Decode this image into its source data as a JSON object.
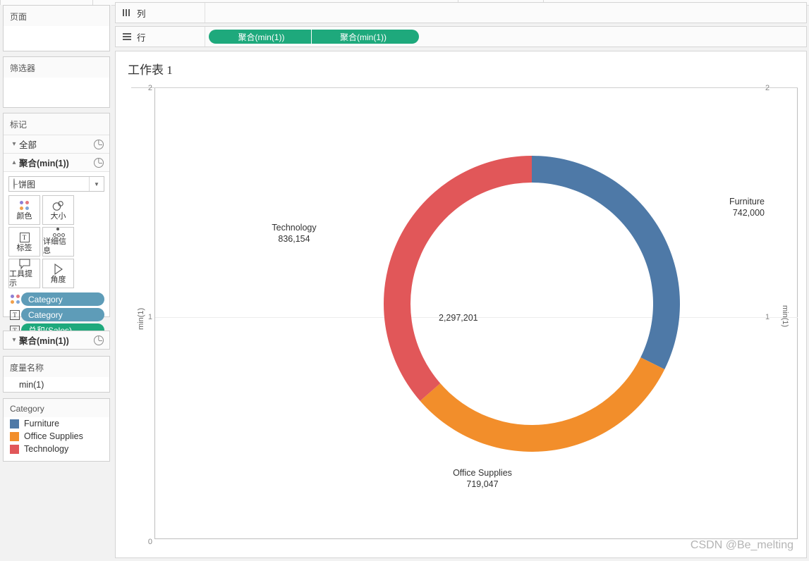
{
  "app": {
    "worksheet_title": "工作表 1",
    "watermark": "CSDN @Be_melting"
  },
  "shelves": {
    "columns": {
      "label": "列",
      "icon": "columns-icon",
      "pills": []
    },
    "rows": {
      "label": "行",
      "icon": "rows-icon",
      "pills": [
        "聚合(min(1))",
        "聚合(min(1))"
      ]
    }
  },
  "sidebar": {
    "pages": {
      "title": "页面"
    },
    "filters": {
      "title": "筛选器"
    },
    "marks": {
      "title": "标记",
      "rows": [
        {
          "label": "全部",
          "caret": "chevron-down",
          "icon": "pie-icon",
          "bold": false
        },
        {
          "label": "聚合(min(1))",
          "caret": "chevron-up",
          "icon": "pie-icon",
          "bold": true
        }
      ],
      "mark_type": "饼图",
      "buttons": [
        {
          "label": "颜色",
          "icon": "color-dots-icon"
        },
        {
          "label": "大小",
          "icon": "size-icon"
        },
        {
          "label": "标签",
          "icon": "label-text-icon"
        },
        {
          "label": "详细信息",
          "icon": "detail-dots-icon"
        },
        {
          "label": "工具提示",
          "icon": "tooltip-icon"
        },
        {
          "label": "角度",
          "icon": "angle-icon"
        }
      ],
      "pills": [
        {
          "text": "Category",
          "color": "blue",
          "icon": "color-dots-icon"
        },
        {
          "text": "Category",
          "color": "blue",
          "icon": "label-text-icon"
        },
        {
          "text": "总和(Sales)",
          "color": "green",
          "icon": "label-text-icon"
        }
      ],
      "second_card": {
        "label": "聚合(min(1))",
        "caret": "chevron-down",
        "icon": "pie-icon"
      }
    },
    "measure_names": {
      "title": "度量名称",
      "item": "min(1)"
    },
    "legend": {
      "title": "Category",
      "items": [
        {
          "label": "Furniture",
          "color": "#4e79a7"
        },
        {
          "label": "Office Supplies",
          "color": "#f28e2b"
        },
        {
          "label": "Technology",
          "color": "#e15759"
        }
      ]
    }
  },
  "chart_data": {
    "type": "pie",
    "title": "工作表 1",
    "subtype": "donut",
    "center_label": "2,297,201",
    "measure": "总和(Sales)",
    "dimension": "Category",
    "categories": [
      "Furniture",
      "Office Supplies",
      "Technology"
    ],
    "values": [
      742000,
      719047,
      836154
    ],
    "value_labels": [
      "742,000",
      "719,047",
      "836,154"
    ],
    "colors": [
      "#4e79a7",
      "#f28e2b",
      "#e15759"
    ],
    "total": 2297201,
    "start_angle_deg": 0,
    "direction": "clockwise",
    "legend_position": "left-sidebar",
    "grid": true,
    "axes": {
      "left": {
        "title": "min(1)",
        "ticks": [
          "2",
          "1",
          "0"
        ],
        "range": [
          0,
          2
        ]
      },
      "right": {
        "title": "min(1)",
        "ticks": [
          "2",
          "1"
        ],
        "range": [
          0,
          2
        ]
      }
    },
    "slice_labels": [
      {
        "name": "Furniture",
        "value": "742,000"
      },
      {
        "name": "Office Supplies",
        "value": "719,047"
      },
      {
        "name": "Technology",
        "value": "836,154"
      }
    ]
  }
}
